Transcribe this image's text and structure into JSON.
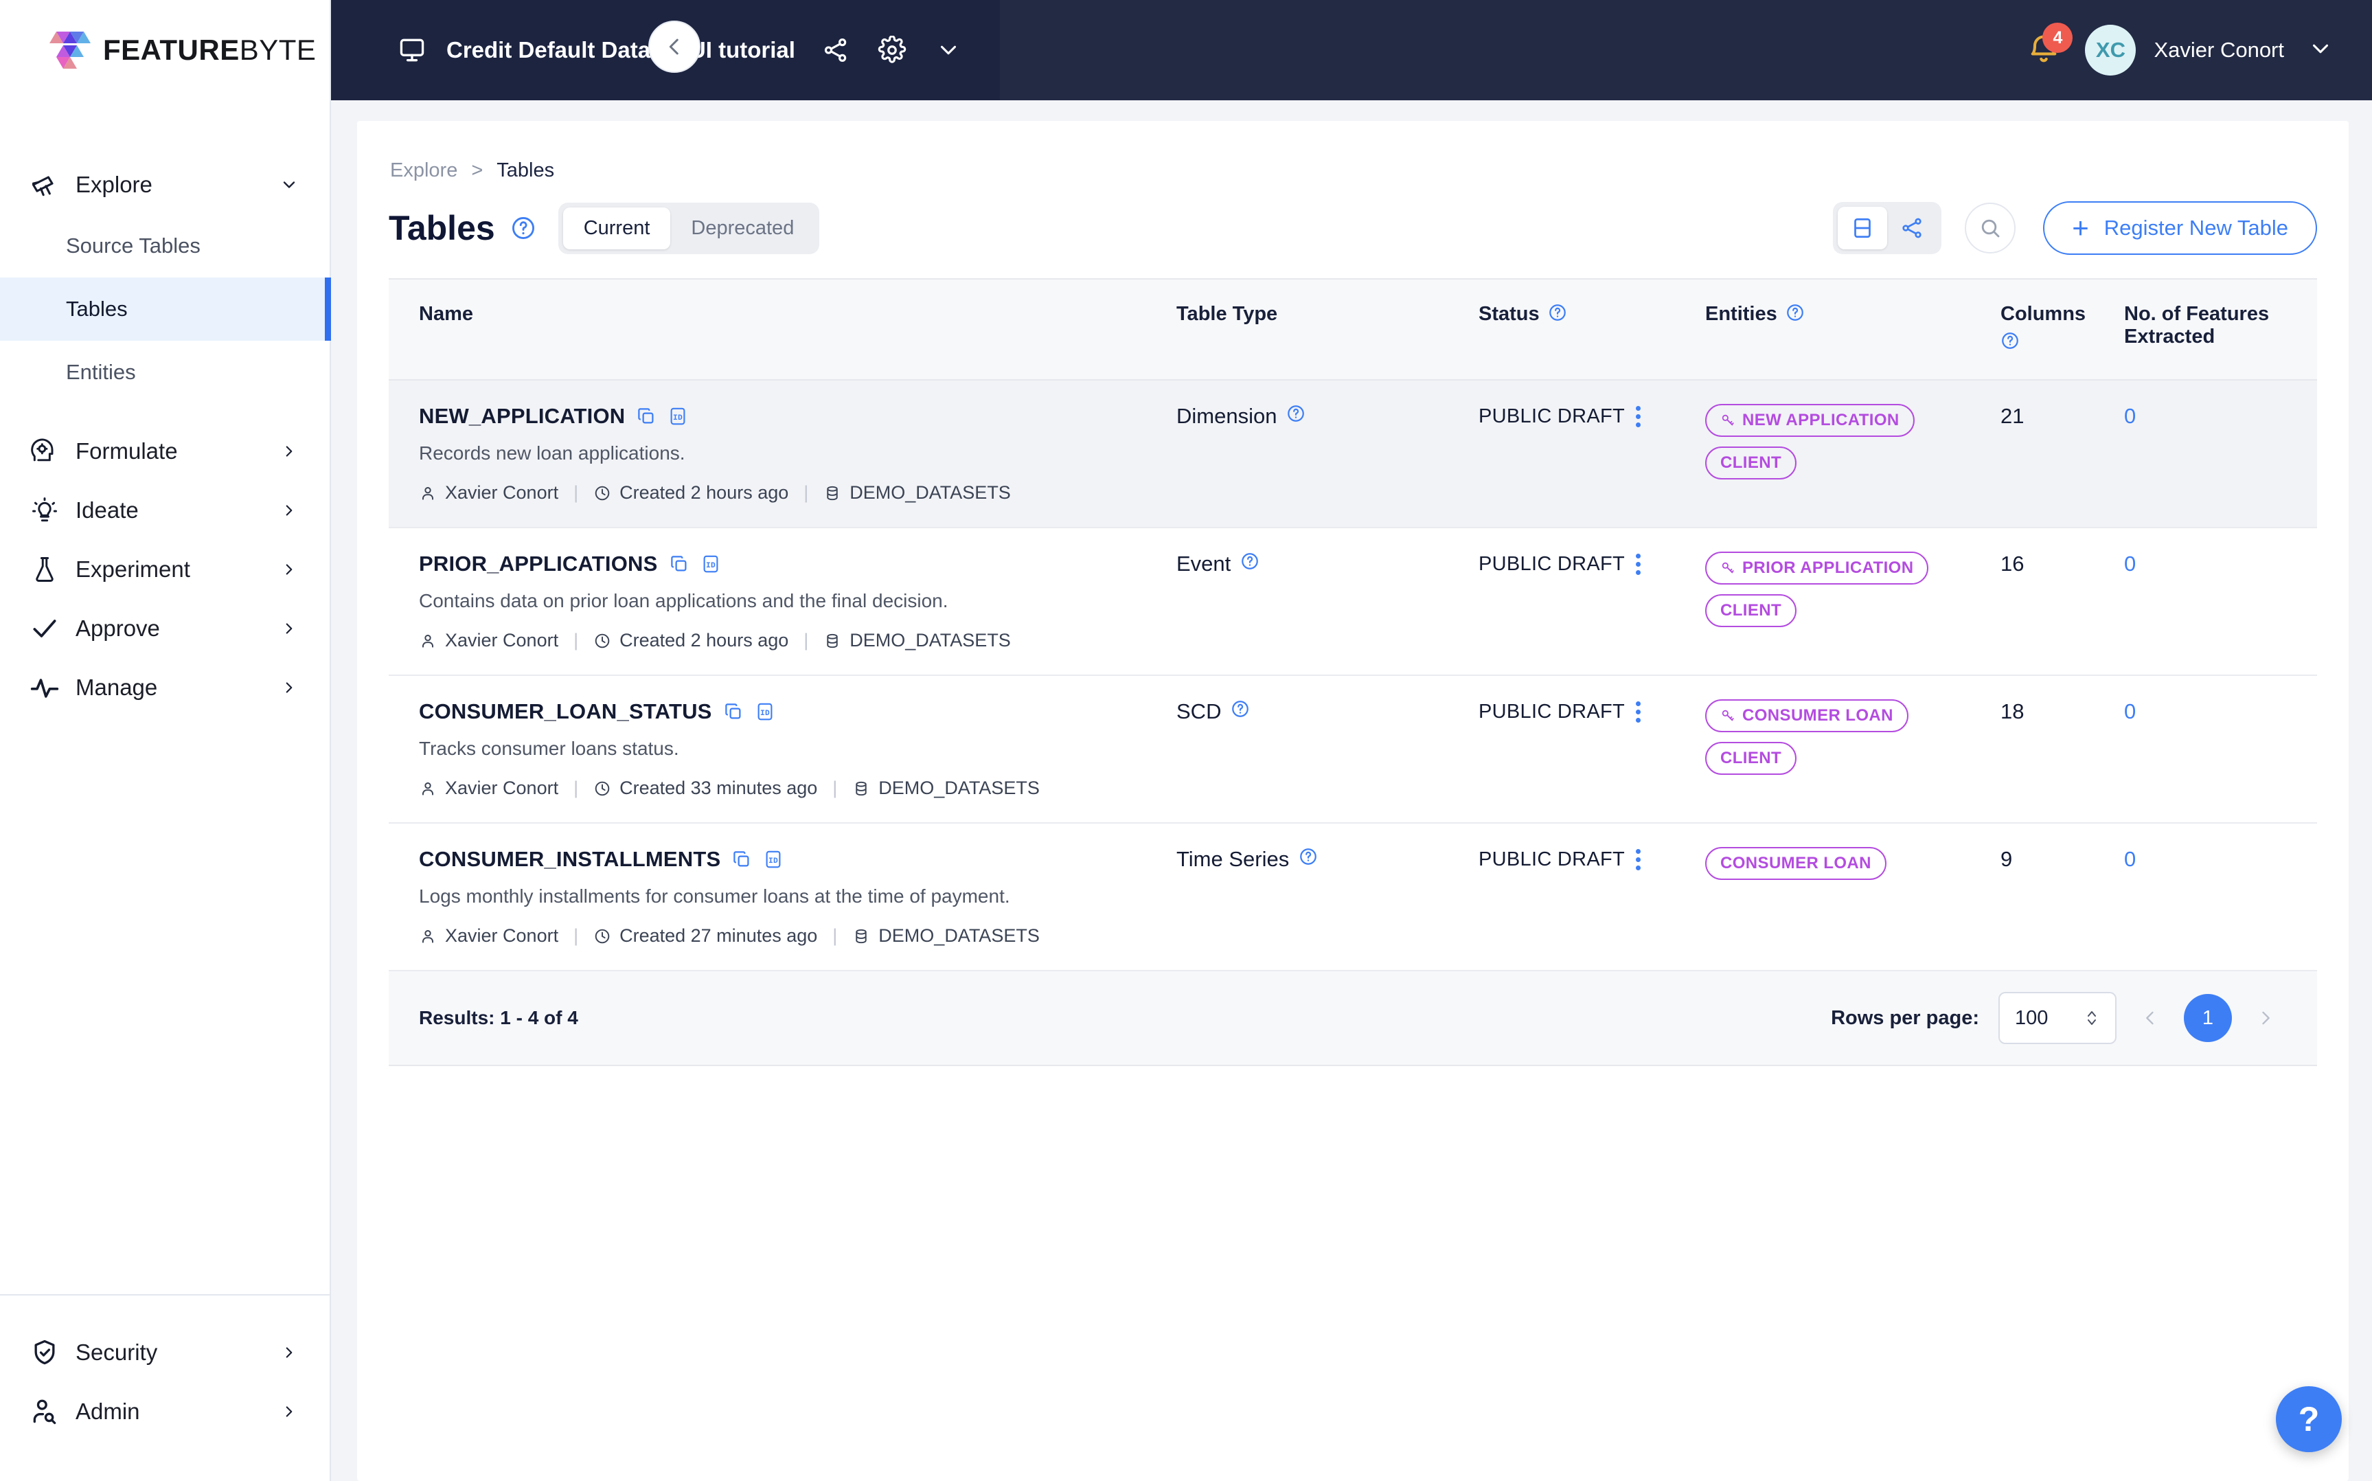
{
  "brand": {
    "name_bold": "FEATURE",
    "name_light": "BYTE"
  },
  "topbar": {
    "workspace_title": "Credit Default Dataset UI tutorial",
    "share_icon": "share-icon",
    "settings_icon": "gear-icon",
    "chevron_icon": "chevron-down-icon",
    "notifications_count": "4",
    "avatar_initials": "XC",
    "user_name": "Xavier Conort"
  },
  "sidebar": {
    "items": [
      {
        "label": "Explore",
        "icon": "telescope-icon",
        "chevron": "chevron-down-icon",
        "expanded": true
      },
      {
        "label": "Formulate",
        "icon": "head-gear-icon",
        "chevron": "chevron-right-icon",
        "expanded": false
      },
      {
        "label": "Ideate",
        "icon": "lightbulb-icon",
        "chevron": "chevron-right-icon",
        "expanded": false
      },
      {
        "label": "Experiment",
        "icon": "flask-icon",
        "chevron": "chevron-right-icon",
        "expanded": false
      },
      {
        "label": "Approve",
        "icon": "check-icon",
        "chevron": "chevron-right-icon",
        "expanded": false
      },
      {
        "label": "Manage",
        "icon": "pulse-icon",
        "chevron": "chevron-right-icon",
        "expanded": false
      }
    ],
    "explore_children": [
      {
        "label": "Source Tables",
        "active": false
      },
      {
        "label": "Tables",
        "active": true
      },
      {
        "label": "Entities",
        "active": false
      }
    ],
    "bottom_items": [
      {
        "label": "Security",
        "icon": "shield-check-icon",
        "chevron": "chevron-right-icon"
      },
      {
        "label": "Admin",
        "icon": "user-search-icon",
        "chevron": "chevron-right-icon"
      }
    ]
  },
  "breadcrumb": {
    "parent": "Explore",
    "separator": ">",
    "current": "Tables"
  },
  "header": {
    "title": "Tables",
    "help_icon": "question-circle-icon",
    "segments": [
      {
        "label": "Current",
        "selected": true
      },
      {
        "label": "Deprecated",
        "selected": false
      }
    ],
    "view_toggle": [
      {
        "icon": "table-view-icon",
        "selected": true
      },
      {
        "icon": "graph-view-icon",
        "selected": false
      }
    ],
    "search_icon": "search-icon",
    "register_button": {
      "label": "Register New Table",
      "icon": "plus-icon"
    }
  },
  "table": {
    "columns": [
      {
        "label": "Name",
        "help": false
      },
      {
        "label": "Table Type",
        "help": false
      },
      {
        "label": "Status",
        "help": true
      },
      {
        "label": "Entities",
        "help": true
      },
      {
        "label": "Columns",
        "help": true
      },
      {
        "label": "No. of Features Extracted",
        "help": false
      }
    ],
    "rows": [
      {
        "name": "NEW_APPLICATION",
        "copy_icon": "copy-icon",
        "id_icon": "id-icon",
        "description": "Records new loan applications.",
        "author": "Xavier Conort",
        "created": "Created 2 hours ago",
        "catalog": "DEMO_DATASETS",
        "table_type": "Dimension",
        "status": "PUBLIC DRAFT",
        "entities": [
          {
            "label": "NEW APPLICATION",
            "primary": true
          },
          {
            "label": "CLIENT",
            "primary": false
          }
        ],
        "columns": "21",
        "features_extracted": "0"
      },
      {
        "name": "PRIOR_APPLICATIONS",
        "copy_icon": "copy-icon",
        "id_icon": "id-icon",
        "description": "Contains data on prior loan applications and the final decision.",
        "author": "Xavier Conort",
        "created": "Created 2 hours ago",
        "catalog": "DEMO_DATASETS",
        "table_type": "Event",
        "status": "PUBLIC DRAFT",
        "entities": [
          {
            "label": "PRIOR APPLICATION",
            "primary": true
          },
          {
            "label": "CLIENT",
            "primary": false
          }
        ],
        "columns": "16",
        "features_extracted": "0"
      },
      {
        "name": "CONSUMER_LOAN_STATUS",
        "copy_icon": "copy-icon",
        "id_icon": "id-icon",
        "description": "Tracks consumer loans status.",
        "author": "Xavier Conort",
        "created": "Created 33 minutes ago",
        "catalog": "DEMO_DATASETS",
        "table_type": "SCD",
        "status": "PUBLIC DRAFT",
        "entities": [
          {
            "label": "CONSUMER LOAN",
            "primary": true
          },
          {
            "label": "CLIENT",
            "primary": false
          }
        ],
        "columns": "18",
        "features_extracted": "0"
      },
      {
        "name": "CONSUMER_INSTALLMENTS",
        "copy_icon": "copy-icon",
        "id_icon": "id-icon",
        "description": "Logs monthly installments for consumer loans at the time of payment.",
        "author": "Xavier Conort",
        "created": "Created 27 minutes ago",
        "catalog": "DEMO_DATASETS",
        "table_type": "Time Series",
        "status": "PUBLIC DRAFT",
        "entities": [
          {
            "label": "CONSUMER LOAN",
            "primary": false
          }
        ],
        "columns": "9",
        "features_extracted": "0"
      }
    ]
  },
  "footer": {
    "results": "Results: 1 - 4 of 4",
    "rows_per_page_label": "Rows per page:",
    "rows_per_page_value": "100",
    "prev_icon": "chevron-left-icon",
    "next_icon": "chevron-right-icon",
    "current_page": "1"
  },
  "fab": {
    "label": "?",
    "icon": "help-icon"
  },
  "colors": {
    "accent_blue": "#3d7ef5",
    "topbar_navy": "#222a44",
    "entity_purple": "#b44ce0",
    "badge_red": "#ef5b4f",
    "avatar_bg": "#ddf2f5"
  }
}
